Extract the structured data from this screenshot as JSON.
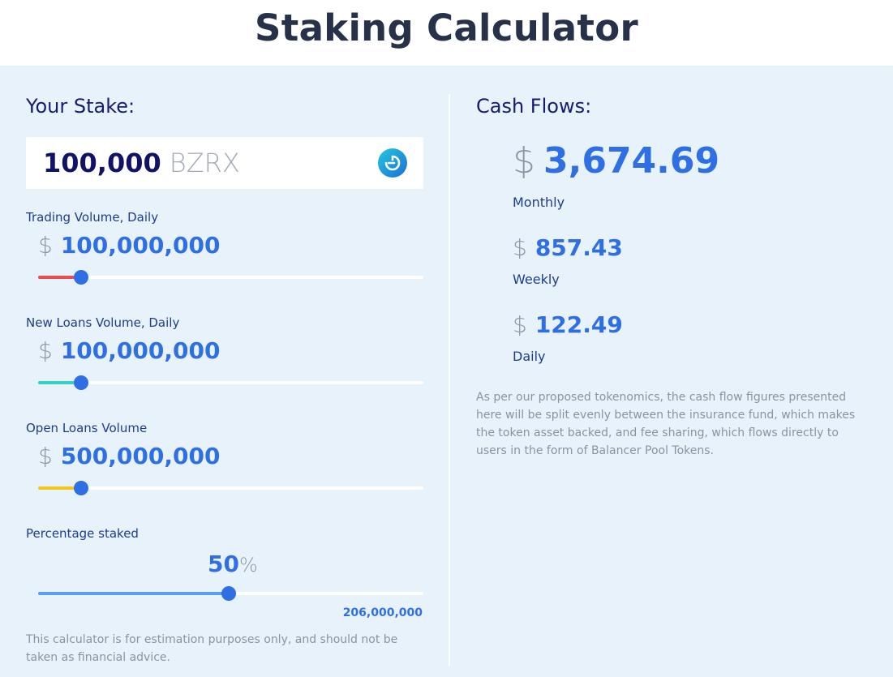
{
  "header": {
    "title": "Staking Calculator"
  },
  "stake": {
    "section_title": "Your Stake:",
    "amount": "100,000",
    "unit": "BZRX",
    "token_icon": "bzrx-token-icon"
  },
  "sliders": [
    {
      "label": "Trading Volume, Daily",
      "currency": "$",
      "value": "100,000,000",
      "fill_color": "#e84e4e",
      "level": 0.11
    },
    {
      "label": "New Loans Volume, Daily",
      "currency": "$",
      "value": "100,000,000",
      "fill_color": "#35d1c8",
      "level": 0.11
    },
    {
      "label": "Open Loans Volume",
      "currency": "$",
      "value": "500,000,000",
      "fill_color": "#f5c518",
      "level": 0.11
    }
  ],
  "percentage": {
    "label": "Percentage staked",
    "value": "50",
    "unit": "%",
    "fill_color": "#5a9ef5",
    "level": 0.5,
    "staked_total": "206,000,000"
  },
  "disclaimer": "This calculator is for estimation purposes only, and should not be taken as financial advice.",
  "cash_flows": {
    "section_title": "Cash Flows:",
    "monthly": {
      "currency": "$",
      "value": "3,674.69",
      "label": "Monthly"
    },
    "weekly": {
      "currency": "$",
      "value": "857.43",
      "label": "Weekly"
    },
    "daily": {
      "currency": "$",
      "value": "122.49",
      "label": "Daily"
    },
    "note": "As per our proposed tokenomics, the cash flow figures presented here will be split evenly between the insurance fund, which makes the token asset backed, and fee sharing, which flows directly to users in the form of Balancer Pool Tokens."
  },
  "colors": {
    "accent": "#2f6fe6",
    "panel_bg": "#e8f2fb",
    "heading": "#1a1b6e"
  }
}
